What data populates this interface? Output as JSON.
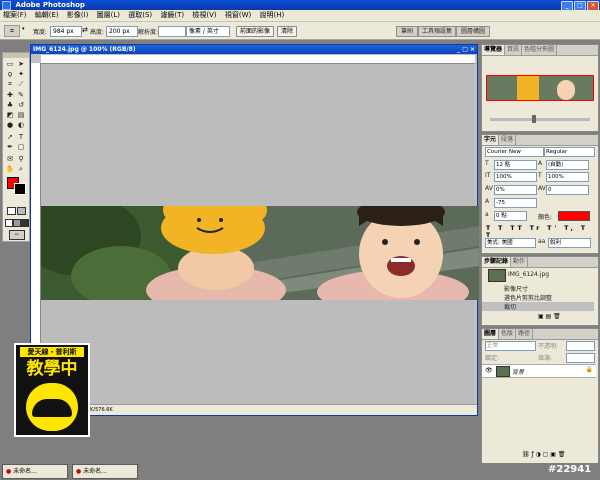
{
  "app": {
    "title": "Adobe Photoshop"
  },
  "menu": [
    "檔案(F)",
    "編輯(E)",
    "影像(I)",
    "圖層(L)",
    "選取(S)",
    "濾鏡(T)",
    "檢視(V)",
    "視窗(W)",
    "說明(H)"
  ],
  "options": {
    "width_label": "寬度:",
    "width_value": "984 px",
    "height_label": "高度:",
    "height_value": "200 px",
    "resolution_label": "解析度:",
    "resolution_value": "",
    "unit": "像素 / 英寸",
    "front_image_button": "前面的影像",
    "clear_button": "清除",
    "wells": [
      "筆刷",
      "工具預設集",
      "圖層構圖"
    ]
  },
  "document": {
    "title": "IMG_6124.jpg @ 100% (RGB/8)",
    "status": "76.6K/576.6K"
  },
  "navigator": {
    "tabs": [
      "導覽器",
      "資訊",
      "色階分佈圖"
    ]
  },
  "character": {
    "tabs": [
      "字元",
      "段落"
    ],
    "font_family": "Courier New",
    "font_style": "Regular",
    "size": "12 點",
    "leading": "(自動)",
    "tracking": "0",
    "vertical_scale": "100%",
    "horizontal_scale": "100%",
    "kerning": "0%",
    "baseline": "-75",
    "baseline_shift": "0 點",
    "color_label": "顏色:",
    "color": "#ff0000",
    "language": "美式: 美國",
    "anti_alias": "銳利"
  },
  "history": {
    "tabs": [
      "步驟記錄",
      "動作"
    ],
    "snapshot": "IMG_6124.jpg",
    "items": [
      "影像尺寸",
      "選色片剪剪比調整",
      "裁切"
    ]
  },
  "layers": {
    "tabs": [
      "圖層",
      "色版",
      "路徑"
    ],
    "blend_mode": "正常",
    "opacity_label": "不透明:",
    "lock_label": "鎖定:",
    "fill_label": "填滿:",
    "layer_name": "背景"
  },
  "taskbar": {
    "items": [
      "未命名...",
      "未命名..."
    ],
    "counter": "#22941"
  },
  "watermark": {
    "line1": "愛天線・普利斯",
    "line2": "教學中"
  }
}
